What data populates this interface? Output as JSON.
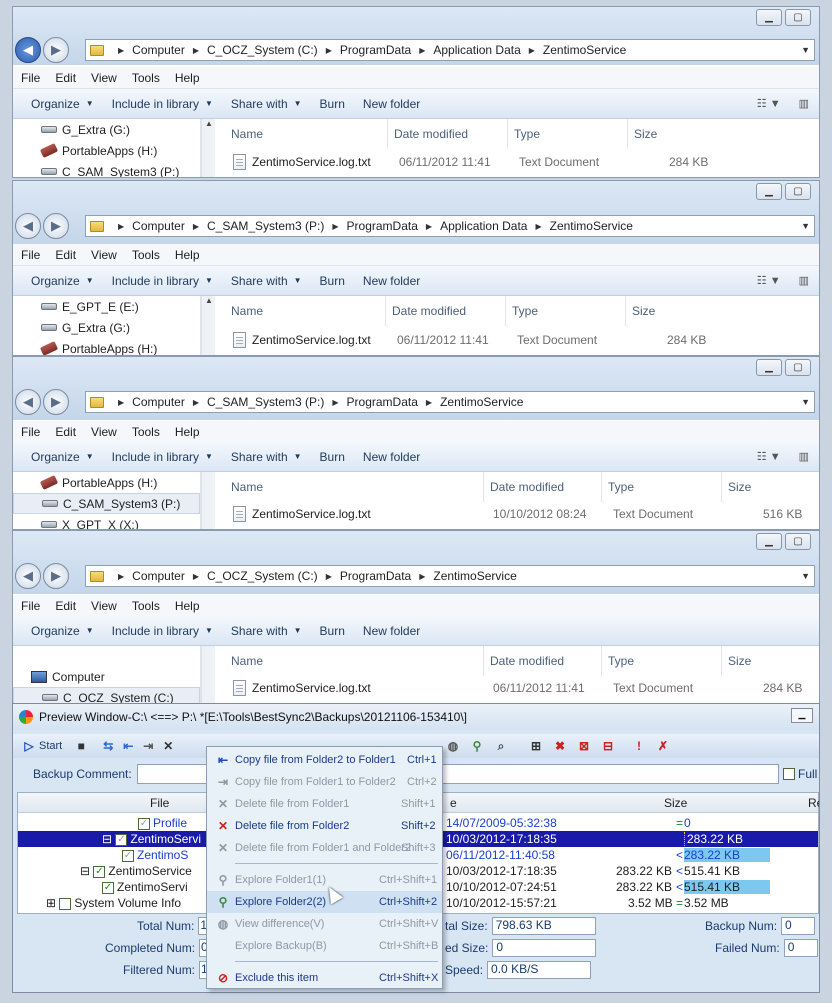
{
  "explorer_windows": [
    {
      "path": [
        "Computer",
        "C_OCZ_System (C:)",
        "ProgramData",
        "Application Data",
        "ZentimoService"
      ],
      "menu": [
        "File",
        "Edit",
        "View",
        "Tools",
        "Help"
      ],
      "commands": [
        "Organize",
        "Include in library",
        "Share with",
        "Burn",
        "New folder"
      ],
      "nav_items": [
        "G_Extra (G:)",
        "PortableApps (H:)",
        "C_SAM_System3 (P:)"
      ],
      "columns": [
        "Name",
        "Date modified",
        "Type",
        "Size"
      ],
      "file": {
        "name": "ZentimoService.log.txt",
        "date": "06/11/2012 11:41",
        "type": "Text Document",
        "size": "284 KB"
      }
    },
    {
      "path": [
        "Computer",
        "C_SAM_System3 (P:)",
        "ProgramData",
        "Application Data",
        "ZentimoService"
      ],
      "menu": [
        "File",
        "Edit",
        "View",
        "Tools",
        "Help"
      ],
      "commands": [
        "Organize",
        "Include in library",
        "Share with",
        "Burn",
        "New folder"
      ],
      "nav_items": [
        "E_GPT_E (E:)",
        "G_Extra (G:)",
        "PortableApps (H:)"
      ],
      "columns": [
        "Name",
        "Date modified",
        "Type",
        "Size"
      ],
      "file": {
        "name": "ZentimoService.log.txt",
        "date": "06/11/2012 11:41",
        "type": "Text Document",
        "size": "284 KB"
      }
    },
    {
      "path": [
        "Computer",
        "C_SAM_System3 (P:)",
        "ProgramData",
        "ZentimoService"
      ],
      "menu": [
        "File",
        "Edit",
        "View",
        "Tools",
        "Help"
      ],
      "commands": [
        "Organize",
        "Include in library",
        "Share with",
        "Burn",
        "New folder"
      ],
      "nav_items": [
        "PortableApps (H:)",
        "C_SAM_System3 (P:)",
        "X_GPT_X (X:)"
      ],
      "columns": [
        "Name",
        "Date modified",
        "Type",
        "Size"
      ],
      "file": {
        "name": "ZentimoService.log.txt",
        "date": "10/10/2012 08:24",
        "type": "Text Document",
        "size": "516 KB"
      }
    },
    {
      "path": [
        "Computer",
        "C_OCZ_System (C:)",
        "ProgramData",
        "ZentimoService"
      ],
      "menu": [
        "File",
        "Edit",
        "View",
        "Tools",
        "Help"
      ],
      "commands": [
        "Organize",
        "Include in library",
        "Share with",
        "Burn",
        "New folder"
      ],
      "nav_items": [
        "Computer",
        "C_OCZ_System (C:)"
      ],
      "columns": [
        "Name",
        "Date modified",
        "Type",
        "Size"
      ],
      "file": {
        "name": "ZentimoService.log.txt",
        "date": "06/11/2012 11:41",
        "type": "Text Document",
        "size": "284 KB"
      }
    }
  ],
  "bestsync": {
    "title": "Preview Window-C:\\ <==> P:\\ *[E:\\Tools\\BestSync2\\Backups\\20121106-153410\\]",
    "start_label": "Start",
    "backup_comment_label": "Backup Comment:",
    "full_label": "Full",
    "grid_headers": {
      "file": "File",
      "e": "e",
      "size": "Size",
      "re": "Re"
    },
    "rows": [
      {
        "name": "Profile",
        "date": "14/07/2009-05:32:38",
        "left": "",
        "mid": "=",
        "right": "0"
      },
      {
        "name": "ZentimoServi",
        "date": "10/03/2012-17:18:35",
        "left": "",
        "mid": "",
        "right": "283.22 KB"
      },
      {
        "name": "ZentimoS",
        "date": "06/11/2012-11:40:58",
        "left": "",
        "mid": "<",
        "right": "283.22 KB"
      },
      {
        "name": "ZentimoService",
        "date": "10/03/2012-17:18:35",
        "left": "283.22 KB",
        "mid": "<",
        "right": "515.41 KB"
      },
      {
        "name": "ZentimoServi",
        "date": "10/10/2012-07:24:51",
        "left": "283.22 KB",
        "mid": "<",
        "right": "515.41 KB"
      },
      {
        "name": "System Volume Info",
        "date": "10/10/2012-15:57:21",
        "left": "3.52 MB",
        "mid": "=",
        "right": "3.52 MB"
      }
    ],
    "stats": {
      "total_num_label": "Total Num:",
      "total_num": "1",
      "completed_num_label": "Completed Num:",
      "completed_num": "0",
      "filtered_num_label": "Filtered Num:",
      "filtered_num": "1",
      "total_size_label": "tal Size:",
      "total_size": "798.63 KB",
      "copied_size_label": "ed Size:",
      "copied_size": "0",
      "speed_label": "Speed:",
      "speed": "0.0 KB/S",
      "backup_num_label": "Backup Num:",
      "backup_num": "0",
      "failed_num_label": "Failed Num:",
      "failed_num": "0"
    }
  },
  "context_menu": [
    {
      "label": "Copy file from Folder2 to Folder1",
      "shortcut": "Ctrl+1",
      "enabled": true
    },
    {
      "label": "Copy file from Folder1 to Folder2",
      "shortcut": "Ctrl+2",
      "enabled": false
    },
    {
      "label": "Delete file from Folder1",
      "shortcut": "Shift+1",
      "enabled": false
    },
    {
      "label": "Delete file from Folder2",
      "shortcut": "Shift+2",
      "enabled": true
    },
    {
      "label": "Delete file from Folder1 and Folder2",
      "shortcut": "Shift+3",
      "enabled": false
    },
    {
      "label": "Explore Folder1(1)",
      "shortcut": "Ctrl+Shift+1",
      "enabled": false
    },
    {
      "label": "Explore Folder2(2)",
      "shortcut": "Ctrl+Shift+2",
      "enabled": true
    },
    {
      "label": "View difference(V)",
      "shortcut": "Ctrl+Shift+V",
      "enabled": false
    },
    {
      "label": "Explore Backup(B)",
      "shortcut": "Ctrl+Shift+B",
      "enabled": false
    },
    {
      "label": "Exclude this item",
      "shortcut": "Ctrl+Shift+X",
      "enabled": true
    }
  ]
}
